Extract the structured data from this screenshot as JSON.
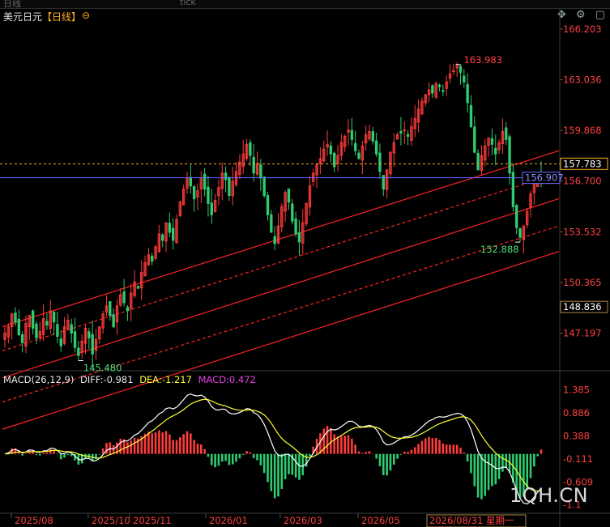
{
  "header": {
    "title": "美元日元",
    "period": "【日线】",
    "settings_glyph": "⊖"
  },
  "toolbar": {
    "icons": [
      "move-icon",
      "gear-icon",
      "window-icon"
    ],
    "move_glyph": "✥",
    "gear_glyph": "⚙",
    "window_glyph": "▢"
  },
  "colors": {
    "up": "#ff3b3b",
    "down": "#2ecc71",
    "channel": "#ff2222",
    "price_line": "#6b6bff",
    "ma_line": "#ffb020",
    "dif": "#ffffff",
    "dea": "#ffff33",
    "price_labels": "#ff4040",
    "low_annotation": "#4ee07a"
  },
  "price_axis": {
    "ticks": [
      "166.203",
      "163.036",
      "159.868",
      "156.700",
      "153.532",
      "150.365",
      "147.197"
    ],
    "current_price": "156.907",
    "ma_price": "157.783",
    "crosshair_price": "148.836"
  },
  "annotations": {
    "high": "163.983",
    "low_left": "145.480",
    "low_right": "152.888"
  },
  "macd": {
    "title": "MACD(26,12,9)",
    "diff": "DIFF:-0.981",
    "dea": "DEA:-1.217",
    "macd": "MACD:0.472",
    "axis_ticks": [
      "1.385",
      "0.886",
      "0.388",
      "-0.111",
      "-0.609",
      "-1.1"
    ]
  },
  "x_axis": {
    "labels": [
      "2025/08",
      "2025/10",
      "2025/11",
      "2026/01",
      "2026/03",
      "2026/05"
    ],
    "cursor_label": "2026/08/31 星期一"
  },
  "watermark": "1QH.CN",
  "chart_data": {
    "type": "candlestick",
    "title": "美元日元",
    "period": "日线",
    "ylim": [
      145.0,
      166.5
    ],
    "close_series": [
      147.2,
      147.6,
      148.4,
      147.9,
      147.1,
      146.6,
      147.8,
      148.3,
      147.5,
      146.9,
      147.3,
      148.1,
      147.7,
      148.6,
      147.9,
      147.0,
      146.4,
      147.6,
      148.0,
      147.2,
      146.3,
      145.8,
      146.7,
      147.5,
      146.9,
      145.9,
      146.8,
      147.6,
      148.4,
      148.9,
      148.3,
      147.6,
      148.9,
      149.6,
      149.1,
      148.6,
      149.7,
      150.4,
      150.0,
      151.0,
      151.6,
      152.1,
      151.7,
      152.6,
      153.4,
      153.0,
      154.1,
      153.5,
      153.0,
      154.3,
      155.4,
      156.2,
      156.9,
      156.4,
      155.6,
      156.1,
      156.9,
      156.2,
      155.3,
      154.6,
      155.5,
      156.3,
      157.2,
      156.8,
      155.8,
      156.7,
      157.3,
      157.9,
      158.4,
      159.0,
      158.3,
      157.2,
      157.8,
      156.9,
      155.8,
      154.6,
      153.5,
      152.8,
      153.9,
      155.1,
      156.0,
      155.4,
      154.2,
      153.4,
      152.9,
      154.1,
      155.3,
      156.4,
      157.2,
      157.7,
      158.1,
      158.7,
      159.0,
      158.4,
      157.6,
      158.3,
      159.1,
      159.5,
      159.9,
      159.3,
      158.6,
      158.1,
      158.9,
      159.6,
      159.8,
      159.2,
      158.4,
      157.3,
      156.2,
      157.4,
      158.5,
      159.1,
      159.6,
      159.7,
      159.9,
      159.5,
      160.1,
      160.6,
      161.2,
      161.7,
      162.1,
      162.4,
      162.2,
      162.8,
      162.6,
      162.3,
      162.9,
      163.4,
      163.6,
      163.9,
      163.5,
      162.9,
      161.6,
      160.1,
      158.5,
      157.4,
      158.3,
      158.9,
      159.4,
      159.0,
      158.4,
      159.1,
      159.8,
      159.3,
      157.2,
      155.1,
      153.8,
      153.2,
      153.9,
      154.8,
      155.9,
      156.6,
      157.0,
      156.9
    ],
    "high": 163.983,
    "low_left": 145.48,
    "low_right": 152.888,
    "last_price": 156.907,
    "ma_price": 157.783,
    "channels": [
      {
        "style": "solid",
        "start": [
          0,
          147.6
        ],
        "end": [
          1,
          158.6
        ]
      },
      {
        "style": "dashed",
        "start": [
          0,
          146.1
        ],
        "end": [
          1,
          157.2
        ]
      },
      {
        "style": "solid",
        "start": [
          0,
          144.4
        ],
        "end": [
          1,
          155.6
        ]
      },
      {
        "style": "dashed",
        "start": [
          0,
          142.9
        ],
        "end": [
          1,
          153.9
        ]
      },
      {
        "style": "solid",
        "start": [
          0,
          141.2
        ],
        "end": [
          1,
          152.3
        ]
      }
    ],
    "macd": {
      "params": [
        26,
        12,
        9
      ],
      "diff_last": -0.981,
      "dea_last": -1.217,
      "macd_last": 0.472,
      "ylim": [
        -1.25,
        1.45
      ]
    }
  }
}
